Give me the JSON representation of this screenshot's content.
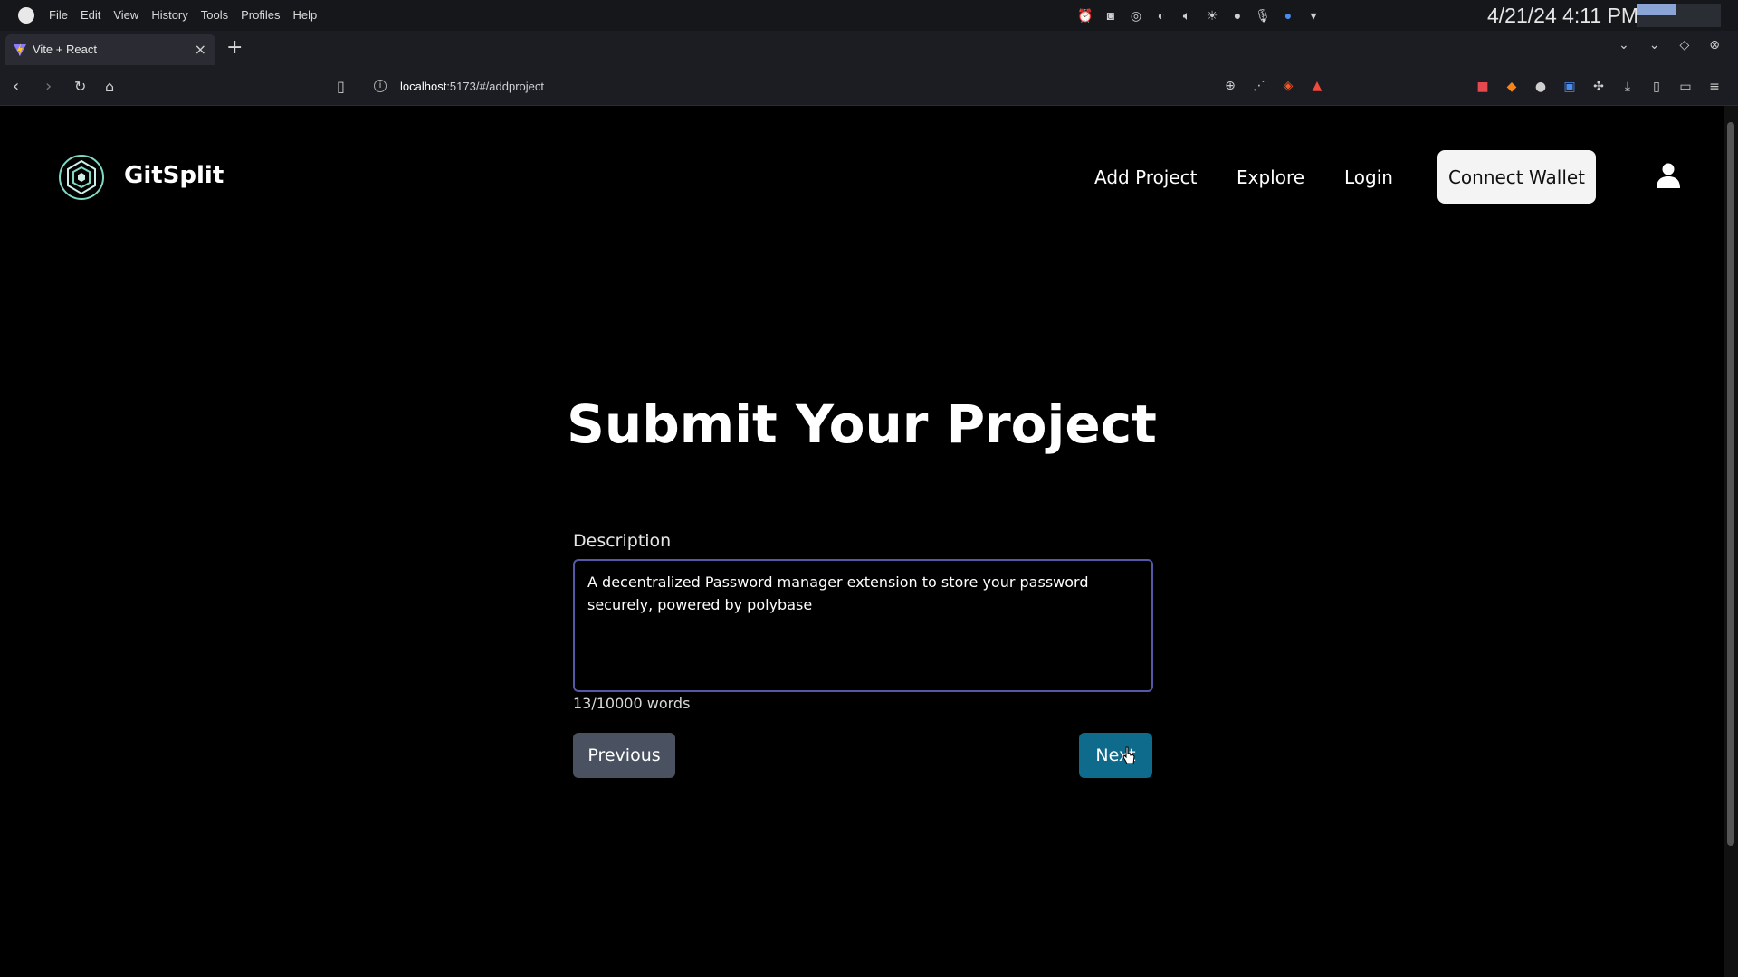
{
  "os": {
    "menu": [
      "File",
      "Edit",
      "View",
      "History",
      "Tools",
      "Profiles",
      "Help"
    ],
    "tray_icons": [
      "alarm-icon",
      "discord-icon",
      "steam-icon",
      "nightlight-icon",
      "volume-icon",
      "brightness-icon",
      "chat-icon",
      "microphone-icon",
      "vpn-icon",
      "dropdown-icon"
    ],
    "clock": "4/21/24 4:11 PM"
  },
  "browser": {
    "tab_title": "Vite + React",
    "url_host": "localhost",
    "url_path": ":5173/#/addproject",
    "close_glyph": "×",
    "newtab_glyph": "+"
  },
  "header": {
    "brand": "GitSplit",
    "nav": [
      "Add Project",
      "Explore",
      "Login"
    ],
    "connect_wallet": "Connect Wallet"
  },
  "main": {
    "title": "Submit Your Project",
    "description_label": "Description",
    "description_value": "A decentralized Password manager extension to store your password securely, powered by polybase",
    "word_count": "13/10000 words",
    "previous": "Previous",
    "next": "Next"
  }
}
